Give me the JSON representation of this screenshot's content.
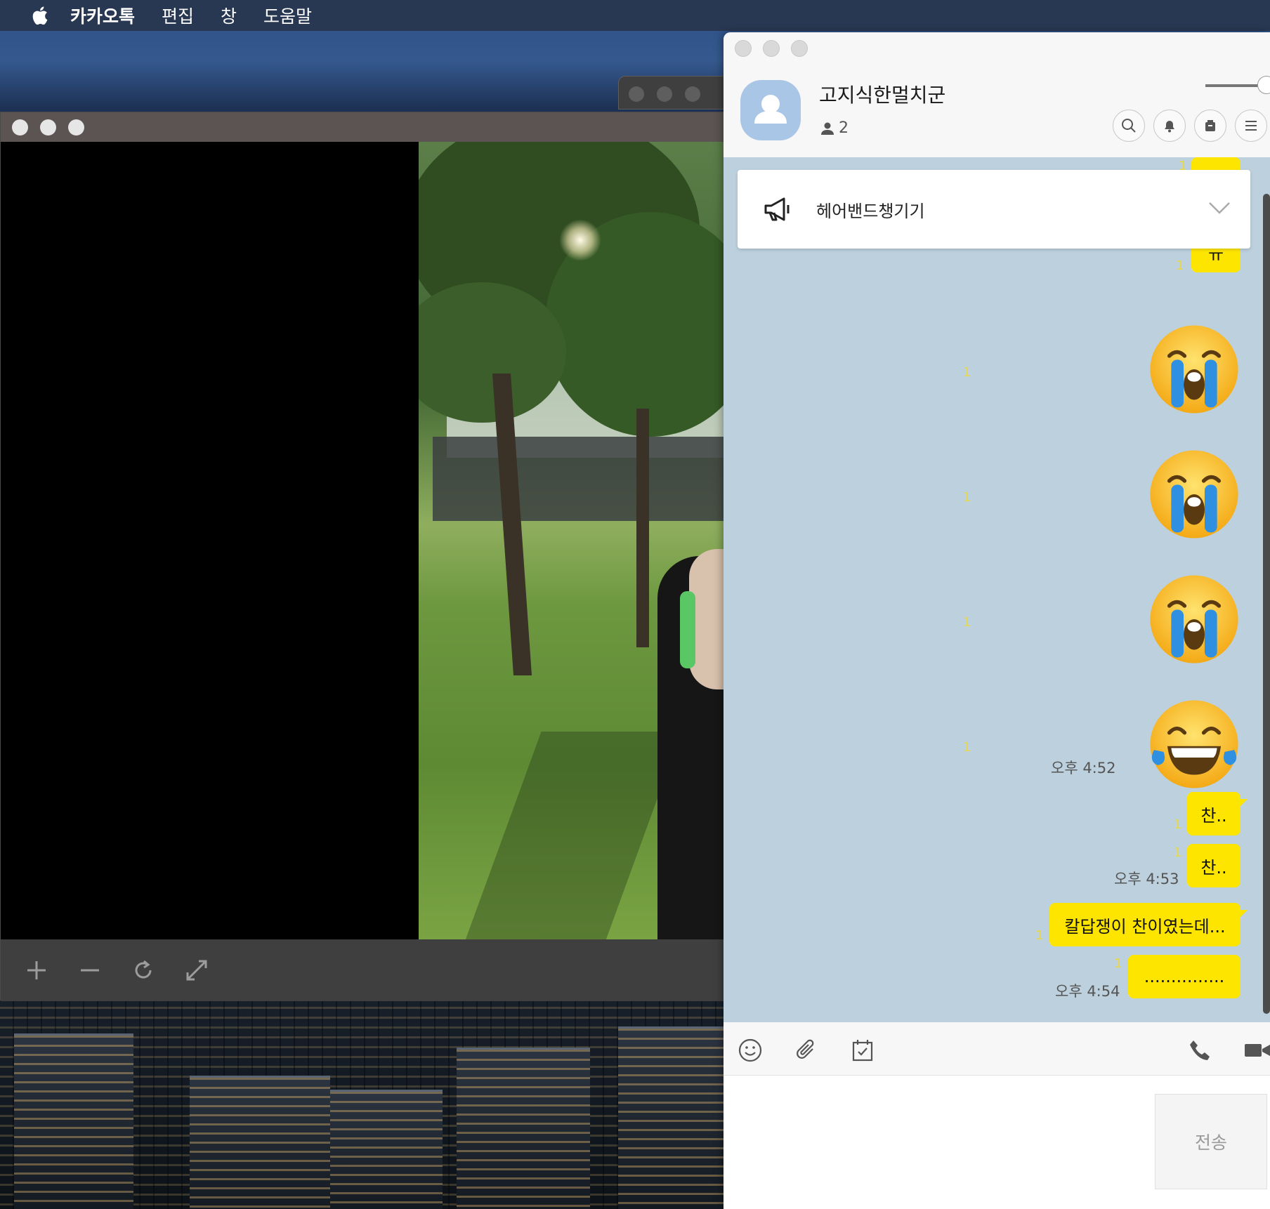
{
  "menubar": {
    "app_name": "카카오톡",
    "items": [
      "편집",
      "창",
      "도움말"
    ]
  },
  "viewer": {
    "toolbar": {
      "zoom_in": "plus-icon",
      "zoom_out": "minus-icon",
      "rotate": "rotate-icon",
      "fullscreen": "expand-icon"
    }
  },
  "chat": {
    "room_title": "고지식한멀치군",
    "member_count": "2",
    "header_buttons": [
      "search-icon",
      "bell-icon",
      "drawer-icon",
      "menu-icon"
    ],
    "notice": {
      "text": "헤어밴드챙기기"
    },
    "messages": {
      "partial_bubble": "ㅠ",
      "emoji_1_unread": "1",
      "emoji_2_unread": "1",
      "emoji_3_unread": "1",
      "emoji_4_unread": "1",
      "time_1": "오후 4:52",
      "msg_1": "찬..",
      "msg_1_unread": "1",
      "msg_2": "찬..",
      "msg_2_unread": "1",
      "time_2": "오후 4:53",
      "msg_3": "칼답쟁이 찬이였는데...",
      "msg_3_unread": "1",
      "msg_4": "...............",
      "msg_4_unread": "1",
      "time_3": "오후 4:54",
      "top_unread": "1",
      "partial_unread": "1"
    },
    "input_tools": [
      "emoji-icon",
      "attach-icon",
      "schedule-icon",
      "phone-icon",
      "video-icon"
    ],
    "send_label": "전송"
  },
  "colors": {
    "bubble": "#fee500",
    "chat_background": "#bcd0dd",
    "menubar": "#293852"
  }
}
